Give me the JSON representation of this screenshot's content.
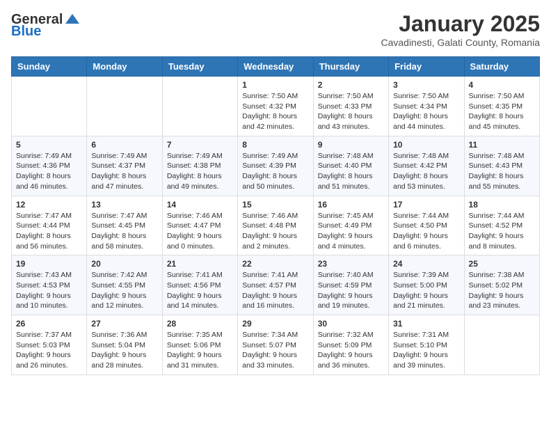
{
  "header": {
    "logo_general": "General",
    "logo_blue": "Blue",
    "month_title": "January 2025",
    "location": "Cavadinesti, Galati County, Romania"
  },
  "weekdays": [
    "Sunday",
    "Monday",
    "Tuesday",
    "Wednesday",
    "Thursday",
    "Friday",
    "Saturday"
  ],
  "weeks": [
    [
      {
        "day": "",
        "sunrise": "",
        "sunset": "",
        "daylight": ""
      },
      {
        "day": "",
        "sunrise": "",
        "sunset": "",
        "daylight": ""
      },
      {
        "day": "",
        "sunrise": "",
        "sunset": "",
        "daylight": ""
      },
      {
        "day": "1",
        "sunrise": "Sunrise: 7:50 AM",
        "sunset": "Sunset: 4:32 PM",
        "daylight": "Daylight: 8 hours and 42 minutes."
      },
      {
        "day": "2",
        "sunrise": "Sunrise: 7:50 AM",
        "sunset": "Sunset: 4:33 PM",
        "daylight": "Daylight: 8 hours and 43 minutes."
      },
      {
        "day": "3",
        "sunrise": "Sunrise: 7:50 AM",
        "sunset": "Sunset: 4:34 PM",
        "daylight": "Daylight: 8 hours and 44 minutes."
      },
      {
        "day": "4",
        "sunrise": "Sunrise: 7:50 AM",
        "sunset": "Sunset: 4:35 PM",
        "daylight": "Daylight: 8 hours and 45 minutes."
      }
    ],
    [
      {
        "day": "5",
        "sunrise": "Sunrise: 7:49 AM",
        "sunset": "Sunset: 4:36 PM",
        "daylight": "Daylight: 8 hours and 46 minutes."
      },
      {
        "day": "6",
        "sunrise": "Sunrise: 7:49 AM",
        "sunset": "Sunset: 4:37 PM",
        "daylight": "Daylight: 8 hours and 47 minutes."
      },
      {
        "day": "7",
        "sunrise": "Sunrise: 7:49 AM",
        "sunset": "Sunset: 4:38 PM",
        "daylight": "Daylight: 8 hours and 49 minutes."
      },
      {
        "day": "8",
        "sunrise": "Sunrise: 7:49 AM",
        "sunset": "Sunset: 4:39 PM",
        "daylight": "Daylight: 8 hours and 50 minutes."
      },
      {
        "day": "9",
        "sunrise": "Sunrise: 7:48 AM",
        "sunset": "Sunset: 4:40 PM",
        "daylight": "Daylight: 8 hours and 51 minutes."
      },
      {
        "day": "10",
        "sunrise": "Sunrise: 7:48 AM",
        "sunset": "Sunset: 4:42 PM",
        "daylight": "Daylight: 8 hours and 53 minutes."
      },
      {
        "day": "11",
        "sunrise": "Sunrise: 7:48 AM",
        "sunset": "Sunset: 4:43 PM",
        "daylight": "Daylight: 8 hours and 55 minutes."
      }
    ],
    [
      {
        "day": "12",
        "sunrise": "Sunrise: 7:47 AM",
        "sunset": "Sunset: 4:44 PM",
        "daylight": "Daylight: 8 hours and 56 minutes."
      },
      {
        "day": "13",
        "sunrise": "Sunrise: 7:47 AM",
        "sunset": "Sunset: 4:45 PM",
        "daylight": "Daylight: 8 hours and 58 minutes."
      },
      {
        "day": "14",
        "sunrise": "Sunrise: 7:46 AM",
        "sunset": "Sunset: 4:47 PM",
        "daylight": "Daylight: 9 hours and 0 minutes."
      },
      {
        "day": "15",
        "sunrise": "Sunrise: 7:46 AM",
        "sunset": "Sunset: 4:48 PM",
        "daylight": "Daylight: 9 hours and 2 minutes."
      },
      {
        "day": "16",
        "sunrise": "Sunrise: 7:45 AM",
        "sunset": "Sunset: 4:49 PM",
        "daylight": "Daylight: 9 hours and 4 minutes."
      },
      {
        "day": "17",
        "sunrise": "Sunrise: 7:44 AM",
        "sunset": "Sunset: 4:50 PM",
        "daylight": "Daylight: 9 hours and 6 minutes."
      },
      {
        "day": "18",
        "sunrise": "Sunrise: 7:44 AM",
        "sunset": "Sunset: 4:52 PM",
        "daylight": "Daylight: 9 hours and 8 minutes."
      }
    ],
    [
      {
        "day": "19",
        "sunrise": "Sunrise: 7:43 AM",
        "sunset": "Sunset: 4:53 PM",
        "daylight": "Daylight: 9 hours and 10 minutes."
      },
      {
        "day": "20",
        "sunrise": "Sunrise: 7:42 AM",
        "sunset": "Sunset: 4:55 PM",
        "daylight": "Daylight: 9 hours and 12 minutes."
      },
      {
        "day": "21",
        "sunrise": "Sunrise: 7:41 AM",
        "sunset": "Sunset: 4:56 PM",
        "daylight": "Daylight: 9 hours and 14 minutes."
      },
      {
        "day": "22",
        "sunrise": "Sunrise: 7:41 AM",
        "sunset": "Sunset: 4:57 PM",
        "daylight": "Daylight: 9 hours and 16 minutes."
      },
      {
        "day": "23",
        "sunrise": "Sunrise: 7:40 AM",
        "sunset": "Sunset: 4:59 PM",
        "daylight": "Daylight: 9 hours and 19 minutes."
      },
      {
        "day": "24",
        "sunrise": "Sunrise: 7:39 AM",
        "sunset": "Sunset: 5:00 PM",
        "daylight": "Daylight: 9 hours and 21 minutes."
      },
      {
        "day": "25",
        "sunrise": "Sunrise: 7:38 AM",
        "sunset": "Sunset: 5:02 PM",
        "daylight": "Daylight: 9 hours and 23 minutes."
      }
    ],
    [
      {
        "day": "26",
        "sunrise": "Sunrise: 7:37 AM",
        "sunset": "Sunset: 5:03 PM",
        "daylight": "Daylight: 9 hours and 26 minutes."
      },
      {
        "day": "27",
        "sunrise": "Sunrise: 7:36 AM",
        "sunset": "Sunset: 5:04 PM",
        "daylight": "Daylight: 9 hours and 28 minutes."
      },
      {
        "day": "28",
        "sunrise": "Sunrise: 7:35 AM",
        "sunset": "Sunset: 5:06 PM",
        "daylight": "Daylight: 9 hours and 31 minutes."
      },
      {
        "day": "29",
        "sunrise": "Sunrise: 7:34 AM",
        "sunset": "Sunset: 5:07 PM",
        "daylight": "Daylight: 9 hours and 33 minutes."
      },
      {
        "day": "30",
        "sunrise": "Sunrise: 7:32 AM",
        "sunset": "Sunset: 5:09 PM",
        "daylight": "Daylight: 9 hours and 36 minutes."
      },
      {
        "day": "31",
        "sunrise": "Sunrise: 7:31 AM",
        "sunset": "Sunset: 5:10 PM",
        "daylight": "Daylight: 9 hours and 39 minutes."
      },
      {
        "day": "",
        "sunrise": "",
        "sunset": "",
        "daylight": ""
      }
    ]
  ]
}
